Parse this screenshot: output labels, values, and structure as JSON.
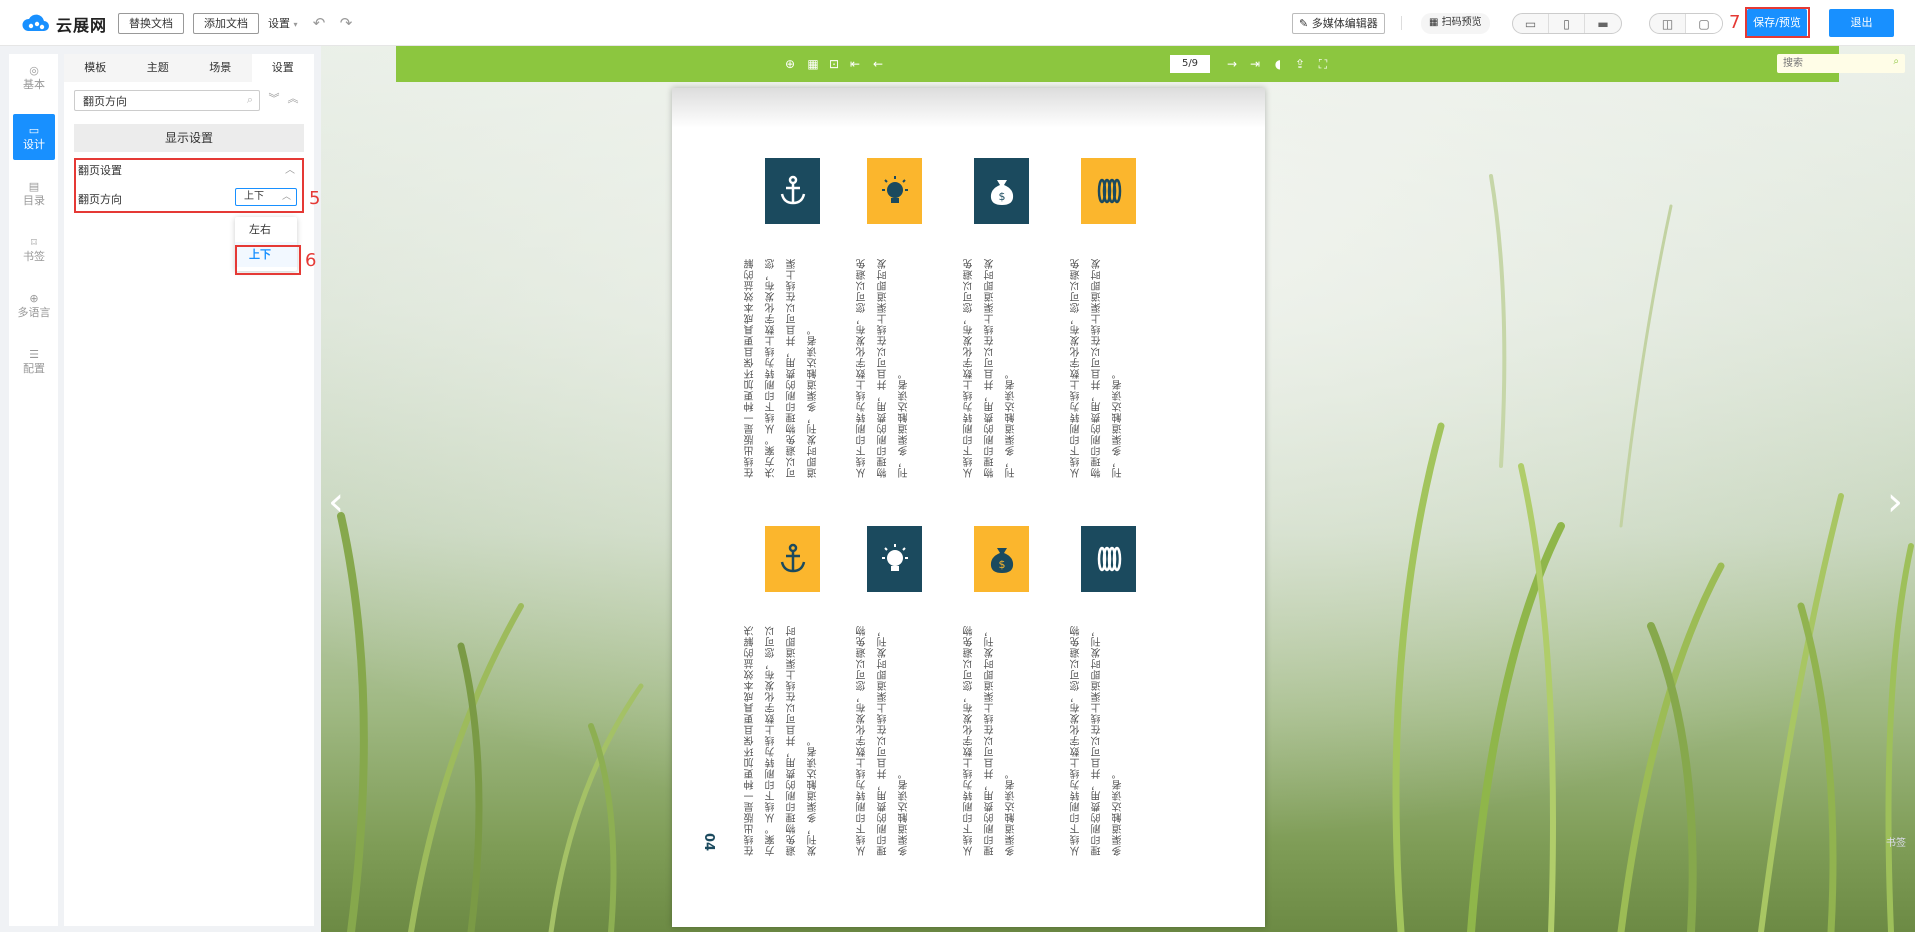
{
  "header": {
    "brand": "云展网",
    "replace_doc": "替换文档",
    "add_doc": "添加文档",
    "settings": "设置",
    "media_editor": "多媒体编辑器",
    "scan_preview": "扫码预览",
    "save_preview": "保存/预览",
    "exit": "退出"
  },
  "annotations": {
    "a5": "5",
    "a6": "6",
    "a7": "7"
  },
  "rail": [
    {
      "label": "基本",
      "icon": "gear-icon"
    },
    {
      "label": "设计",
      "icon": "monitor-icon"
    },
    {
      "label": "目录",
      "icon": "list-icon"
    },
    {
      "label": "书签",
      "icon": "bookmark-icon"
    },
    {
      "label": "多语言",
      "icon": "globe-icon"
    },
    {
      "label": "配置",
      "icon": "sliders-icon"
    }
  ],
  "panel": {
    "tabs": [
      "模板",
      "主题",
      "场景",
      "设置"
    ],
    "search_value": "翻页方向",
    "section": "显示设置",
    "group": "翻页设置",
    "row_label": "翻页方向",
    "select_value": "上下",
    "options": [
      "左右",
      "上下"
    ]
  },
  "stage": {
    "page_indicator": "5/9",
    "search_placeholder": "搜索",
    "corner": "书签",
    "page_number": "04",
    "colors": {
      "navy": "#1b4a5e",
      "gold": "#fbb62d",
      "toolbar": "#8cc63f"
    },
    "text_a": "从线下印刷转为线上数字化发布，您可以避免物理印刷的费用，并且可以在线上渠道即时发刊，多渠道触达读者。",
    "text_b": "在线出版是一种更加环保且更具成本效益的解决方案。从线下印刷转为线上数字化发布，您可以避免物理印刷的费用，并且可以在线上渠道即时发刊，多渠道触达读者。"
  }
}
